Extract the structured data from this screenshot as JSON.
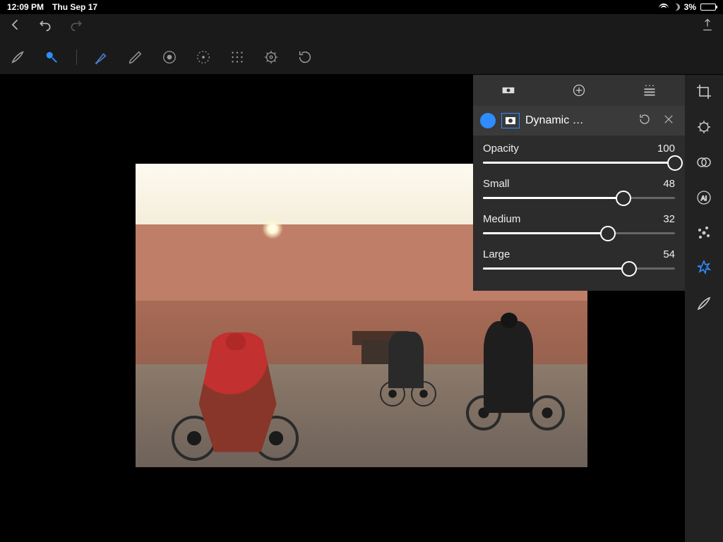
{
  "status": {
    "time": "12:09 PM",
    "date": "Thu Sep 17",
    "battery_pct": "3%"
  },
  "filter": {
    "title": "Dynamic …"
  },
  "sliders": {
    "opacity": {
      "label": "Opacity",
      "value": "100",
      "pct": 100
    },
    "small": {
      "label": "Small",
      "value": "48",
      "pct": 73
    },
    "medium": {
      "label": "Medium",
      "value": "32",
      "pct": 65
    },
    "large": {
      "label": "Large",
      "value": "54",
      "pct": 76
    }
  }
}
